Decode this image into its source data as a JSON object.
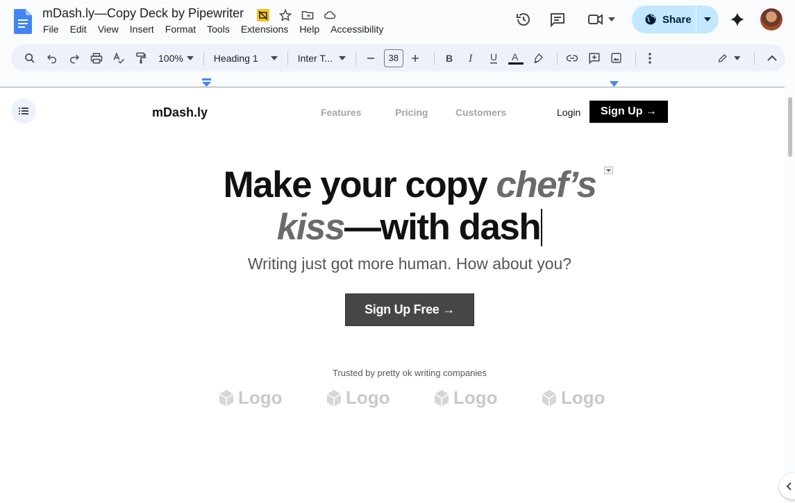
{
  "document": {
    "title": "mDash.ly—Copy Deck by Pipewriter"
  },
  "menu": [
    "File",
    "Edit",
    "View",
    "Insert",
    "Format",
    "Tools",
    "Extensions",
    "Help",
    "Accessibility"
  ],
  "share": {
    "label": "Share"
  },
  "toolbar": {
    "zoom": "100%",
    "style": "Heading 1",
    "font": "Inter T...",
    "font_size": "38"
  },
  "page": {
    "nav": {
      "logo": "mDash.ly",
      "links": [
        "Features",
        "Pricing",
        "Customers"
      ],
      "login": "Login",
      "signup": "Sign Up →"
    },
    "hero": {
      "line1_plain": "Make your copy ",
      "line1_em": "chef’s",
      "line2_em": "kiss",
      "line2_plain": "—with dash",
      "subhead": "Writing just got more human. How about you?",
      "cta": "Sign Up Free →"
    },
    "trusted": {
      "label": "Trusted by pretty ok writing companies",
      "logos": [
        "Logo",
        "Logo",
        "Logo",
        "Logo"
      ]
    }
  },
  "colors": {
    "accent": "#c2e7ff",
    "toolbar_bg": "#edf2fa",
    "cta_bg": "#464646",
    "signup_bg": "#000000"
  }
}
